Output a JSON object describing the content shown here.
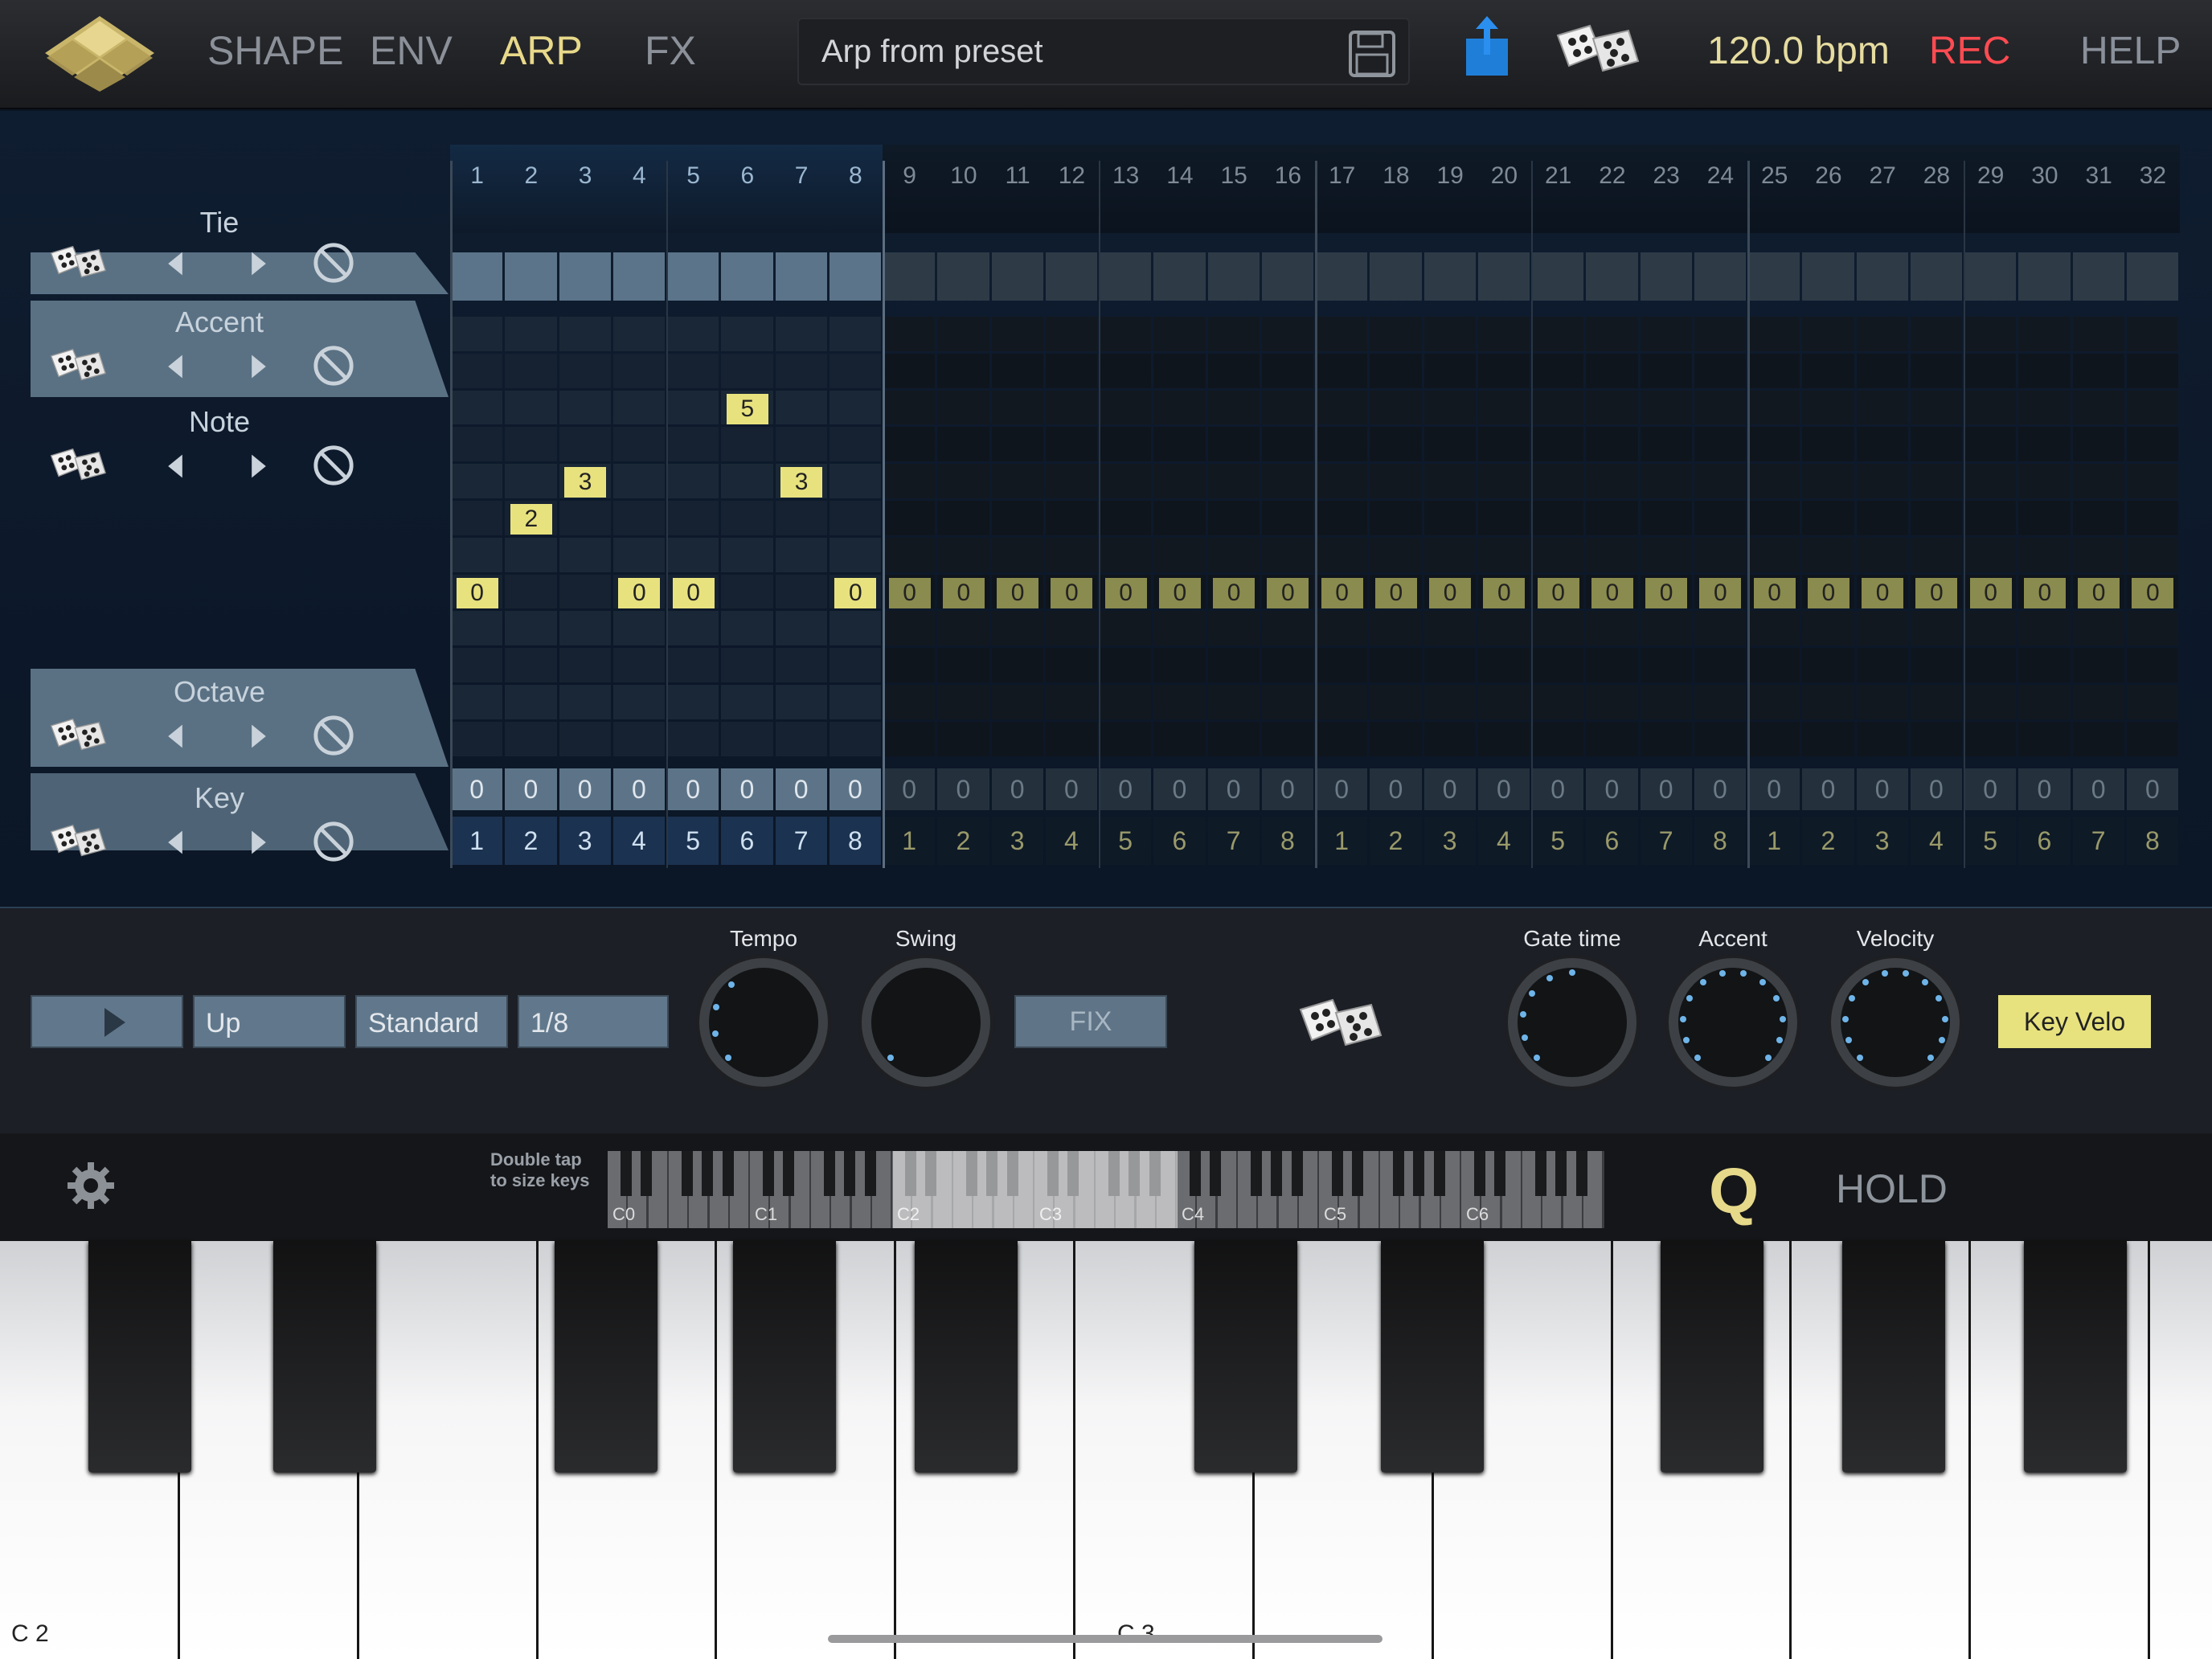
{
  "nav": {
    "shape": "SHAPE",
    "env": "ENV",
    "arp": "ARP",
    "fx": "FX"
  },
  "preset": {
    "name": "Arp from preset"
  },
  "header": {
    "tempo": "120.0 bpm",
    "rec": "REC",
    "help": "HELP"
  },
  "sequencer": {
    "rows": {
      "tie": "Tie",
      "accent": "Accent",
      "note": "Note",
      "octave": "Octave",
      "key": "Key"
    },
    "steps": [
      "1",
      "2",
      "3",
      "4",
      "5",
      "6",
      "7",
      "8",
      "9",
      "10",
      "11",
      "12",
      "13",
      "14",
      "15",
      "16",
      "17",
      "18",
      "19",
      "20",
      "21",
      "22",
      "23",
      "24",
      "25",
      "26",
      "27",
      "28",
      "29",
      "30",
      "31",
      "32"
    ],
    "active_steps": 8,
    "playhead_step": 1,
    "accent_values": [
      0,
      0,
      0,
      0,
      0,
      5,
      0,
      0
    ],
    "note_values": [
      "0",
      "2",
      "3",
      "0",
      "0",
      "5",
      "3",
      "0",
      "0",
      "0",
      "0",
      "0",
      "0",
      "0",
      "0",
      "0",
      "0",
      "0",
      "0",
      "0",
      "0",
      "0",
      "0",
      "0",
      "0",
      "0",
      "0",
      "0",
      "0",
      "0",
      "0",
      "0"
    ],
    "note_rows_from_top": [
      7,
      5,
      4,
      7,
      7,
      2,
      4,
      7,
      7,
      7,
      7,
      7,
      7,
      7,
      7,
      7,
      7,
      7,
      7,
      7,
      7,
      7,
      7,
      7,
      7,
      7,
      7,
      7,
      7,
      7,
      7,
      7
    ],
    "octave_values": [
      "0",
      "0",
      "0",
      "0",
      "0",
      "0",
      "0",
      "0",
      "0",
      "0",
      "0",
      "0",
      "0",
      "0",
      "0",
      "0",
      "0",
      "0",
      "0",
      "0",
      "0",
      "0",
      "0",
      "0",
      "0",
      "0",
      "0",
      "0",
      "0",
      "0",
      "0",
      "0"
    ],
    "key_values": [
      "1",
      "2",
      "3",
      "4",
      "5",
      "6",
      "7",
      "8",
      "1",
      "2",
      "3",
      "4",
      "5",
      "6",
      "7",
      "8",
      "1",
      "2",
      "3",
      "4",
      "5",
      "6",
      "7",
      "8",
      "1",
      "2",
      "3",
      "4",
      "5",
      "6",
      "7",
      "8"
    ]
  },
  "controls": {
    "direction": "Up",
    "mode": "Standard",
    "rate": "1/8",
    "tempo_label": "Tempo",
    "swing_label": "Swing",
    "fix": "FIX",
    "gate_label": "Gate time",
    "accent_label": "Accent",
    "velocity_label": "Velocity",
    "key_velo": "Key Velo"
  },
  "keyboard": {
    "hint_line1": "Double tap",
    "hint_line2": "to size keys",
    "octave_labels": [
      "C0",
      "C1",
      "C2",
      "C3",
      "C4",
      "C5",
      "C6"
    ],
    "hold": "HOLD",
    "q": "Q",
    "low_label": "C 2",
    "mid_label": "C 3"
  },
  "colors": {
    "accent_yellow": "#e8e27e",
    "rec_red": "#ff4b52",
    "active_nav": "#e8d98a",
    "step_active": "#5c7489"
  }
}
